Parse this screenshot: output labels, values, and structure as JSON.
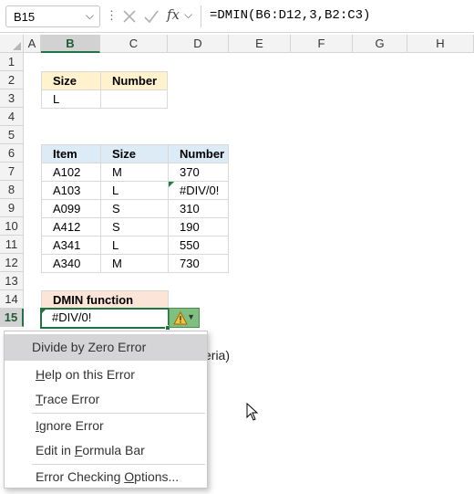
{
  "formula_bar": {
    "name_box": "B15",
    "fx_label": "fx",
    "formula": "=DMIN(B6:D12,3,B2:C3)"
  },
  "columns": [
    "A",
    "B",
    "C",
    "D",
    "E",
    "F",
    "G",
    "H"
  ],
  "rows": [
    "1",
    "2",
    "3",
    "4",
    "5",
    "6",
    "7",
    "8",
    "9",
    "10",
    "11",
    "12",
    "13",
    "14",
    "15"
  ],
  "criteria": {
    "headers": [
      "Size",
      "Number"
    ],
    "row": [
      "L",
      ""
    ]
  },
  "table": {
    "headers": [
      "Item",
      "Size",
      "Number"
    ],
    "rows": [
      [
        "A102",
        "M",
        "370"
      ],
      [
        "A103",
        "L",
        "#DIV/0!"
      ],
      [
        "A099",
        "S",
        "310"
      ],
      [
        "A412",
        "S",
        "190"
      ],
      [
        "A341",
        "L",
        "550"
      ],
      [
        "A340",
        "M",
        "730"
      ]
    ]
  },
  "dmin": {
    "label": "DMIN function",
    "result": "#DIV/0!"
  },
  "obscured_text": "eria)",
  "error_menu": {
    "title": "Divide by Zero Error",
    "items": [
      {
        "pre": "",
        "u": "H",
        "post": "elp on this Error"
      },
      {
        "pre": "",
        "u": "T",
        "post": "race Error"
      },
      {
        "pre": "",
        "u": "I",
        "post": "gnore Error"
      },
      {
        "pre": "Edit in ",
        "u": "F",
        "post": "ormula Bar"
      },
      {
        "pre": "Error Checking ",
        "u": "O",
        "post": "ptions..."
      }
    ]
  },
  "colors": {
    "accent": "#217346",
    "criteria_header": "#fff2cc",
    "table_header": "#ddebf7",
    "function_header": "#fce4d6"
  }
}
